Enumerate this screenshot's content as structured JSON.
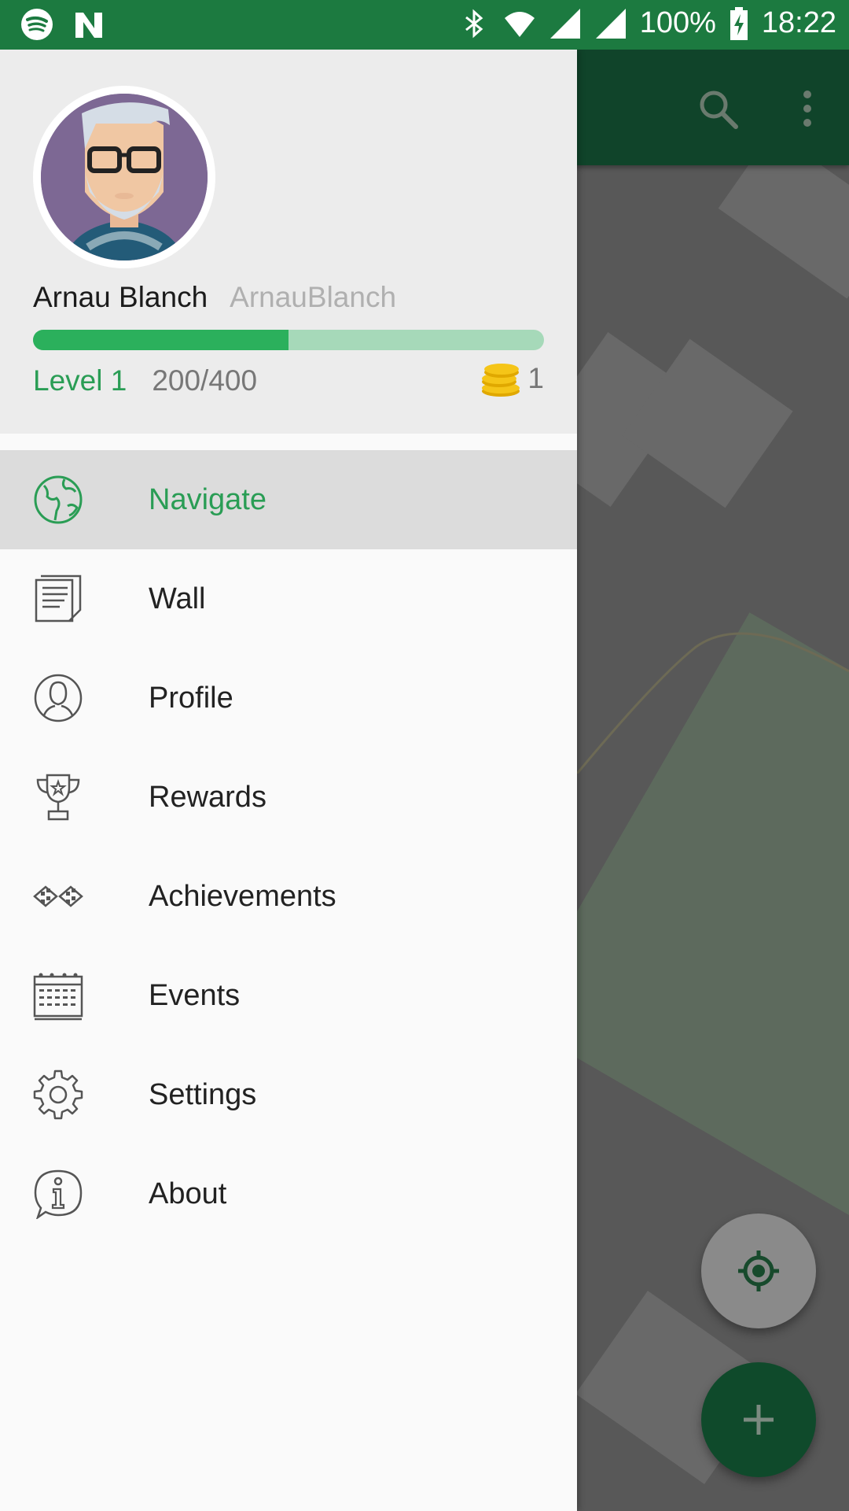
{
  "status_bar": {
    "battery": "100%",
    "time": "18:22"
  },
  "user": {
    "name": "Arnau Blanch",
    "username": "ArnauBlanch",
    "level": "Level 1",
    "xp": "200/400",
    "xp_progress": 0.5,
    "coins": "1"
  },
  "menu": {
    "items": [
      {
        "label": "Navigate",
        "icon": "globe-icon",
        "active": true
      },
      {
        "label": "Wall",
        "icon": "document-icon"
      },
      {
        "label": "Profile",
        "icon": "person-icon"
      },
      {
        "label": "Rewards",
        "icon": "trophy-icon"
      },
      {
        "label": "Achievements",
        "icon": "checkered-flags-icon"
      },
      {
        "label": "Events",
        "icon": "calendar-icon"
      },
      {
        "label": "Settings",
        "icon": "gear-icon"
      },
      {
        "label": "About",
        "icon": "info-icon"
      }
    ]
  },
  "colors": {
    "accent": "#2a9d55",
    "status_bar": "#1c7a40",
    "app_bar": "#10442a"
  }
}
